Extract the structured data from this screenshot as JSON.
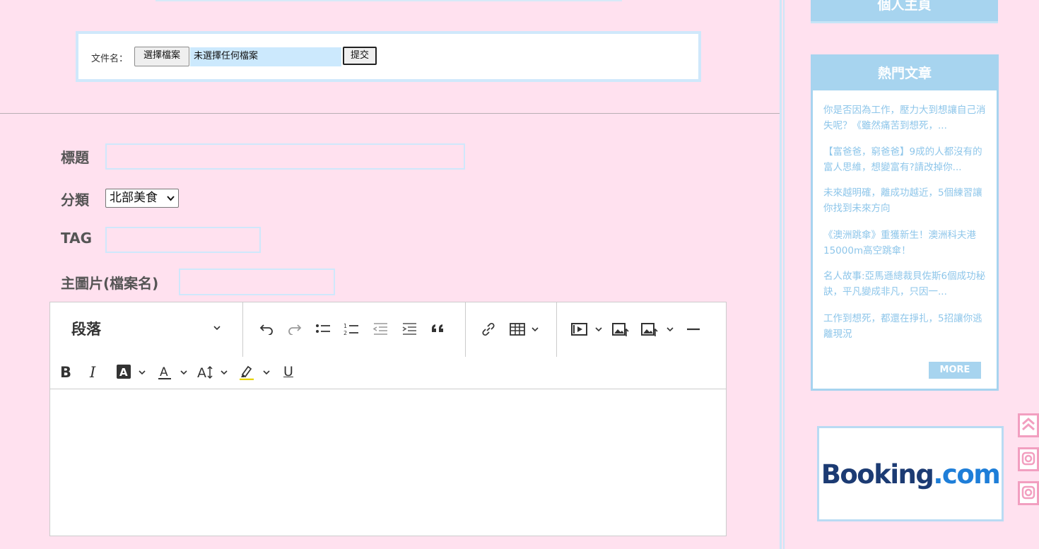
{
  "upload": {
    "label": "文件名：",
    "choose_button": "選擇檔案",
    "no_file_text": "未選擇任何檔案",
    "submit_button": "提交"
  },
  "form": {
    "title_label": "標題",
    "title_value": "",
    "category_label": "分類",
    "category_selected": "北部美食",
    "tag_label": "TAG",
    "tag_value": "",
    "main_image_label": "主圖片(檔案名)",
    "main_image_value": ""
  },
  "editor": {
    "heading_select": "段落",
    "icons": [
      "undo-icon",
      "redo-icon",
      "bulleted-list-icon",
      "numbered-list-icon",
      "outdent-icon",
      "indent-icon",
      "blockquote-icon",
      "link-icon",
      "table-icon",
      "media-icon",
      "image-upload-icon",
      "image-insert-icon",
      "horizontal-line-icon",
      "bold-icon",
      "italic-icon",
      "highlight-color-icon",
      "font-color-icon",
      "font-size-icon",
      "marker-icon",
      "underline-icon"
    ],
    "bold_label": "B",
    "italic_label": "I",
    "underline_label": "U",
    "content": ""
  },
  "sidebar": {
    "personal_title": "個人主頁",
    "hot_title": "熱門文章",
    "hot_articles": [
      "你是否因為工作，壓力大到想讓自己消失呢？《雖然痛苦到想死，...",
      "【富爸爸，窮爸爸】9成的人都沒有的富人思維，想變富有?請改掉你...",
      "未來越明確，離成功越近，5個練習讓你找到未來方向",
      "《澳洲跳傘》重獲新生！澳洲科夫港15000m高空跳傘！",
      "名人故事:亞馬遜總裁貝佐斯6個成功秘訣，平凡變成非凡，只因一...",
      "工作到想死，都還在掙扎，5招讓你逃離現況"
    ],
    "more_button": "MORE",
    "booking_logo_main": "Booking",
    "booking_logo_dot": ".com"
  },
  "colors": {
    "page_bg": "#ffe1ef",
    "accent_blue": "#a7d4ef",
    "link_blue": "#8ec6ea",
    "pink_icon": "#f29fc0"
  }
}
